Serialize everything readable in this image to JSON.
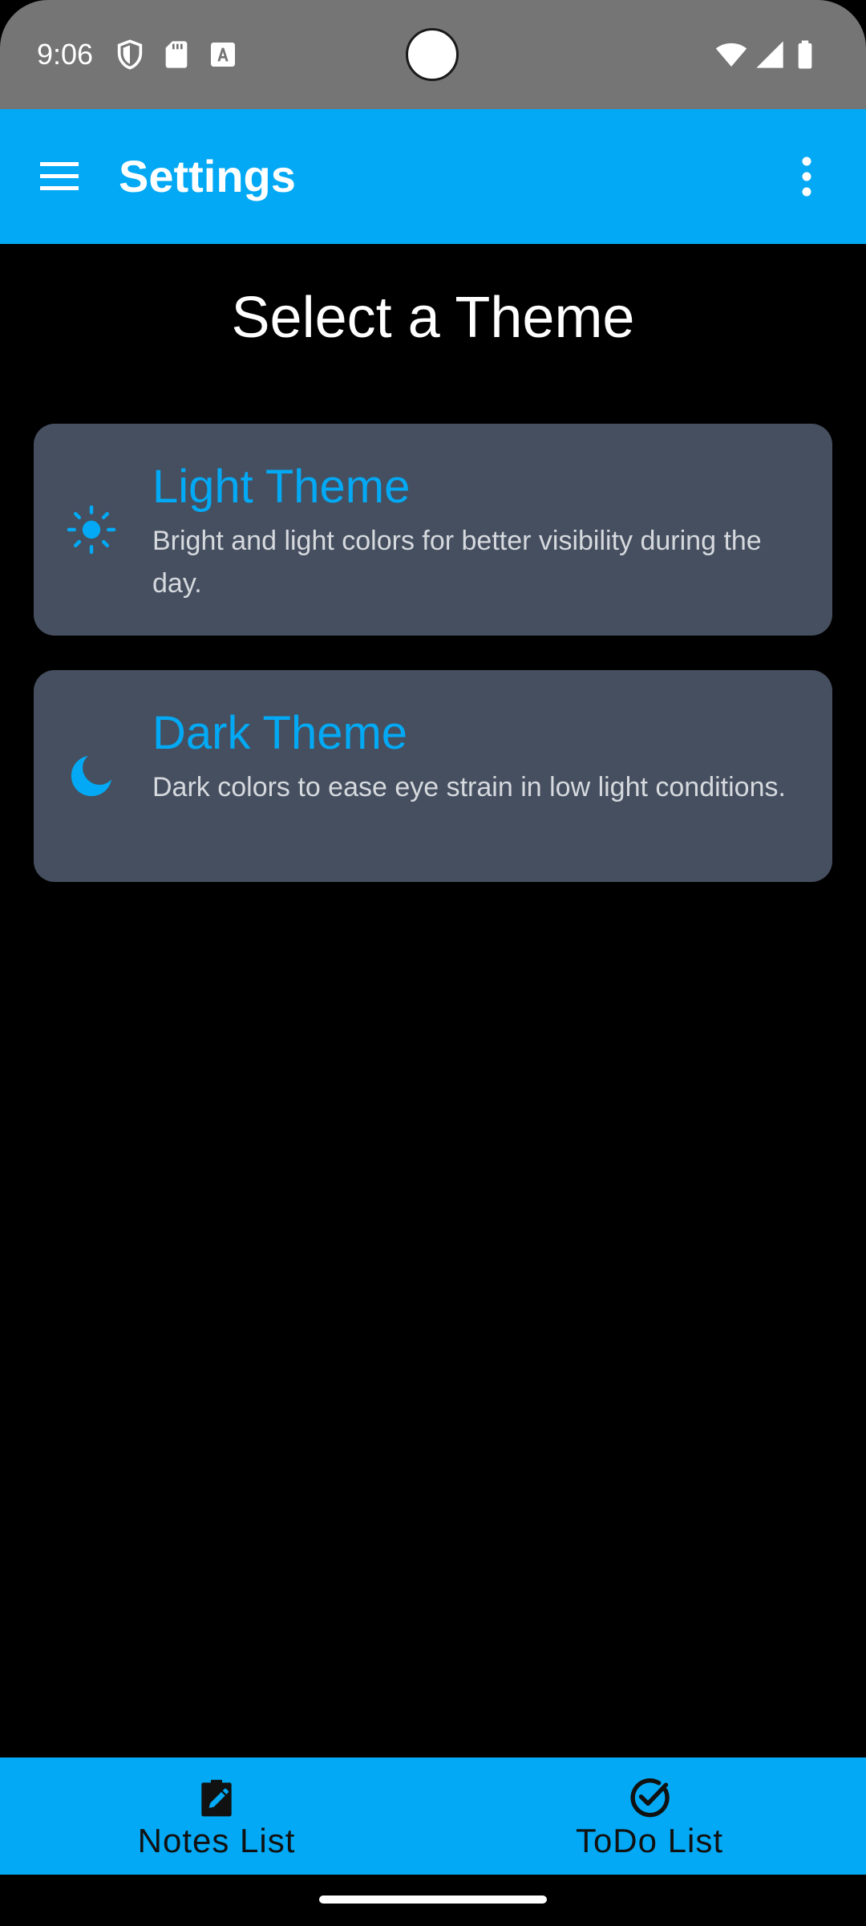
{
  "status_bar": {
    "time": "9:06",
    "left_icons": [
      "shield-icon",
      "sd-card-icon",
      "font-download-icon"
    ],
    "right_icons": [
      "wifi-icon",
      "signal-icon",
      "battery-icon"
    ]
  },
  "app_bar": {
    "title": "Settings",
    "menu_icon": "hamburger-menu-icon",
    "overflow_icon": "more-vert-icon",
    "color": "#03A9F4"
  },
  "main": {
    "heading": "Select a Theme",
    "themes": [
      {
        "title": "Light Theme",
        "description": "Bright and light colors for better visibility during the day.",
        "icon": "sun-icon"
      },
      {
        "title": "Dark Theme",
        "description": "Dark colors to ease eye strain in low light conditions.",
        "icon": "moon-icon"
      }
    ],
    "card_color": "#454F5F",
    "accent_color": "#03A9F4"
  },
  "bottom_nav": {
    "items": [
      {
        "label": "Notes List",
        "icon": "clipboard-edit-icon"
      },
      {
        "label": "ToDo List",
        "icon": "check-circle-icon"
      }
    ]
  }
}
